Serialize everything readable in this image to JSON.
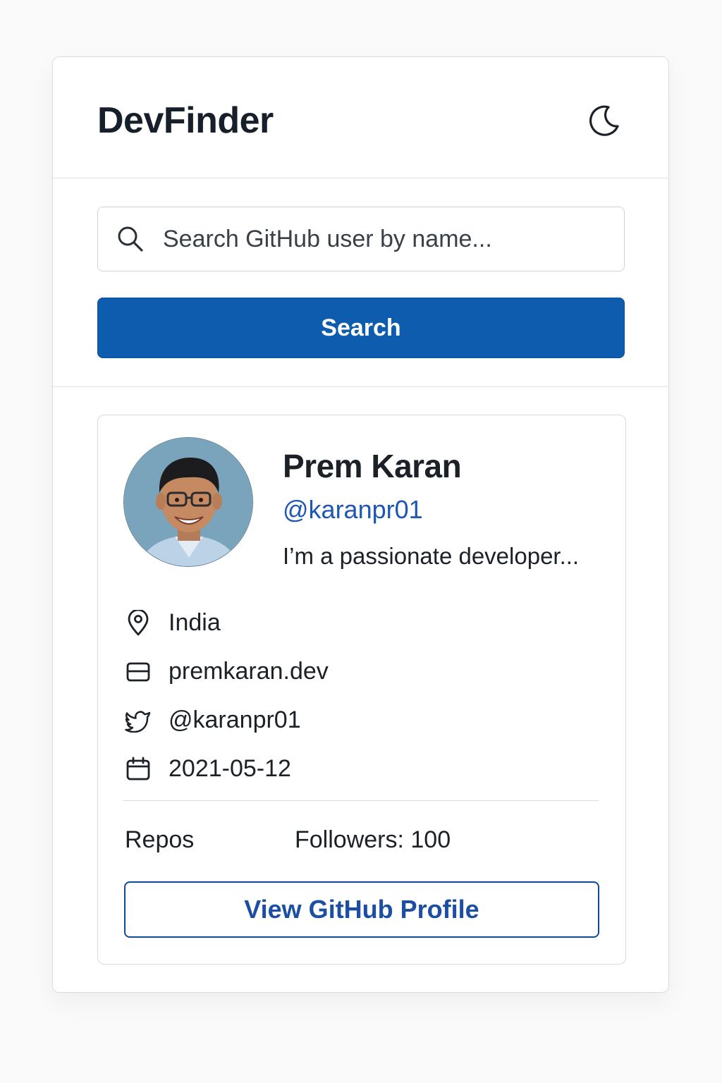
{
  "header": {
    "title": "DevFinder",
    "theme_toggle_icon": "moon-icon"
  },
  "search": {
    "placeholder": "Search GitHub user by name...",
    "value": "",
    "button_label": "Search",
    "icon": "search-icon"
  },
  "profile": {
    "name": "Prem Karan",
    "handle": "@karanpr01",
    "bio": "I’m a passionate developer...",
    "avatar_icon": "user-avatar-photo",
    "meta": [
      {
        "icon": "location-pin-icon",
        "text": "India"
      },
      {
        "icon": "website-card-icon",
        "text": "premkaran.dev"
      },
      {
        "icon": "twitter-icon",
        "text": "@karanpr01"
      },
      {
        "icon": "calendar-icon",
        "text": "2021-05-12"
      }
    ],
    "stats": {
      "repos_label": "Repos",
      "followers_label": "Followers: 100"
    },
    "view_profile_label": "View GitHub Profile"
  },
  "colors": {
    "primary": "#0e5cad",
    "link": "#1e56b4",
    "text": "#1c2128",
    "border": "#d6d9dd"
  }
}
